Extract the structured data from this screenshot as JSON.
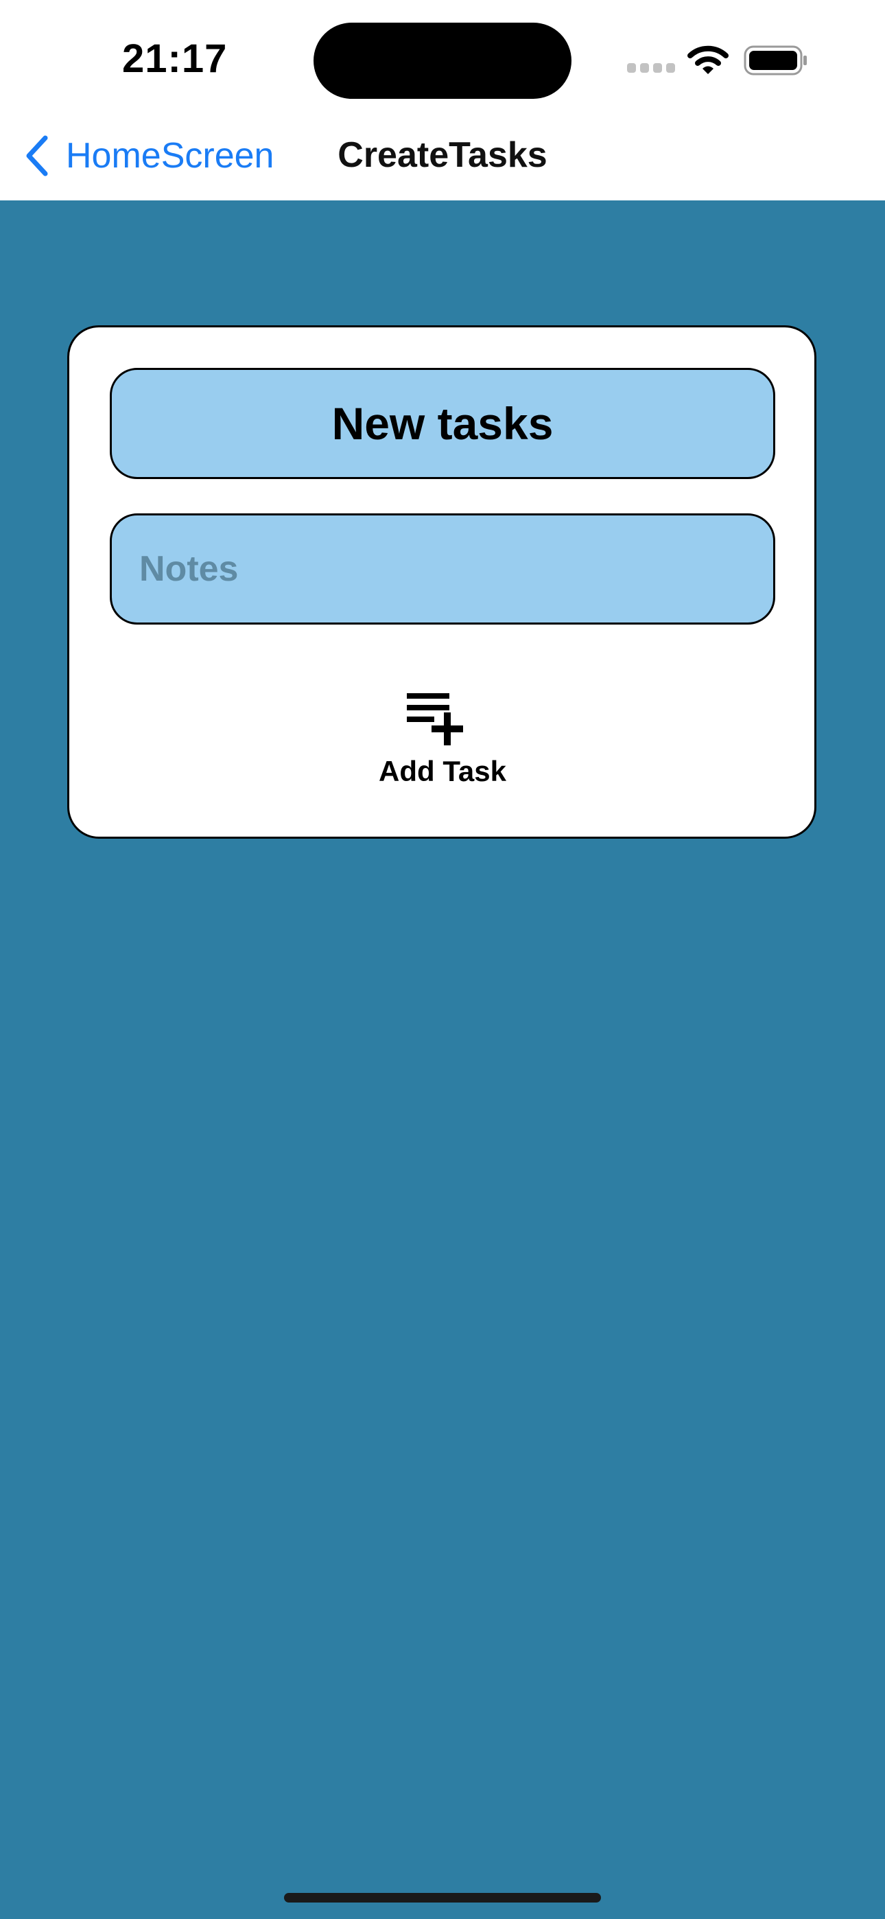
{
  "status_bar": {
    "time": "21:17",
    "icons": [
      "signal-icon",
      "wifi-icon",
      "battery-icon"
    ]
  },
  "nav": {
    "back_label": "HomeScreen",
    "title": "CreateTasks",
    "back_icon": "chevron-left-icon"
  },
  "form": {
    "title_value": "New tasks",
    "notes_placeholder": "Notes",
    "add_button_label": "Add Task",
    "add_button_icon": "playlist-add-icon"
  },
  "colors": {
    "background": "#2e7ea3",
    "field": "#99cdef",
    "accent": "#1a7cf5"
  }
}
